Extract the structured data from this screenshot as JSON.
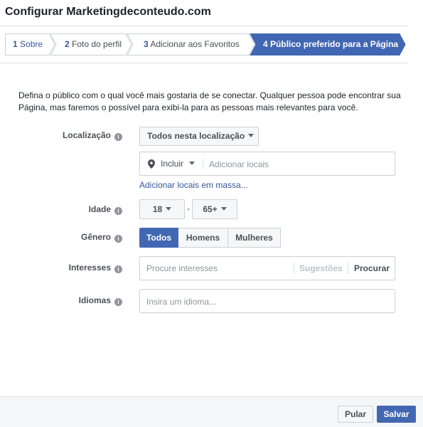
{
  "dialog": {
    "title": "Configurar Marketingdeconteudo.com"
  },
  "steps": [
    {
      "num": "1",
      "label": "Sobre"
    },
    {
      "num": "2",
      "label": "Foto do perfil"
    },
    {
      "num": "3",
      "label": "Adicionar aos Favoritos"
    },
    {
      "num": "4",
      "label": "Público preferido para a Página"
    }
  ],
  "active_step": 4,
  "description": "Defina o público com o qual você mais gostaria de se conectar. Qualquer pessoa pode encontrar sua Página, mas faremos o possível para exibi-la para as pessoas mais relevantes para você.",
  "location": {
    "label": "Localização",
    "scope_value": "Todos nesta localização",
    "include_value": "Incluir",
    "search_placeholder": "Adicionar locais",
    "bulk_link": "Adicionar locais em massa..."
  },
  "age": {
    "label": "Idade",
    "min": "18",
    "separator": "-",
    "max": "65+"
  },
  "gender": {
    "label": "Gênero",
    "options": [
      "Todos",
      "Homens",
      "Mulheres"
    ],
    "selected": "Todos"
  },
  "interests": {
    "label": "Interesses",
    "placeholder": "Procure interesses",
    "suggestions": "Sugestões",
    "browse": "Procurar"
  },
  "languages": {
    "label": "Idiomas",
    "placeholder": "Insira um idioma..."
  },
  "footer": {
    "skip": "Pular",
    "save": "Salvar"
  },
  "colors": {
    "primary": "#4267b2",
    "link": "#365899",
    "border": "#ccd0d5"
  }
}
